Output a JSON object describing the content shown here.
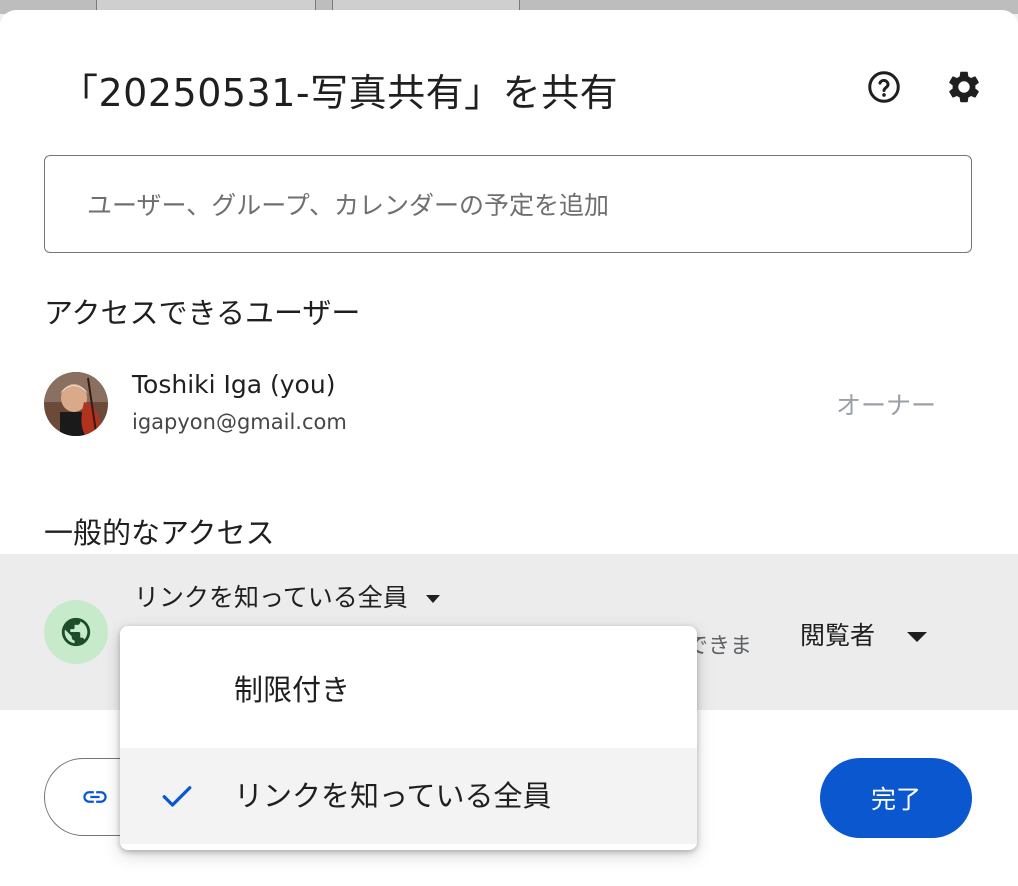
{
  "dialog": {
    "title": "「20250531-写真共有」を共有",
    "help_icon": "help-circle-icon",
    "settings_icon": "gear-icon"
  },
  "add_people": {
    "placeholder": "ユーザー、グループ、カレンダーの予定を追加"
  },
  "people_with_access": {
    "heading": "アクセスできるユーザー",
    "users": [
      {
        "name": "Toshiki Iga (you)",
        "email": "igapyon@gmail.com",
        "role": "オーナー"
      }
    ]
  },
  "general_access": {
    "heading": "一般的なアクセス",
    "selected": "リンクを知っている全員",
    "description_fragment": "できま",
    "role": "閲覧者",
    "icon": "globe-icon",
    "icon_bg_color": "#c7eacb",
    "icon_color": "#1e4d2b"
  },
  "access_dropdown": {
    "options": [
      {
        "label": "制限付き",
        "selected": false
      },
      {
        "label": "リンクを知っている全員",
        "selected": true
      }
    ],
    "check_color": "#0b57d0"
  },
  "footer": {
    "copy_link_icon": "link-icon",
    "done_label": "完了",
    "done_color": "#0b57d0"
  }
}
